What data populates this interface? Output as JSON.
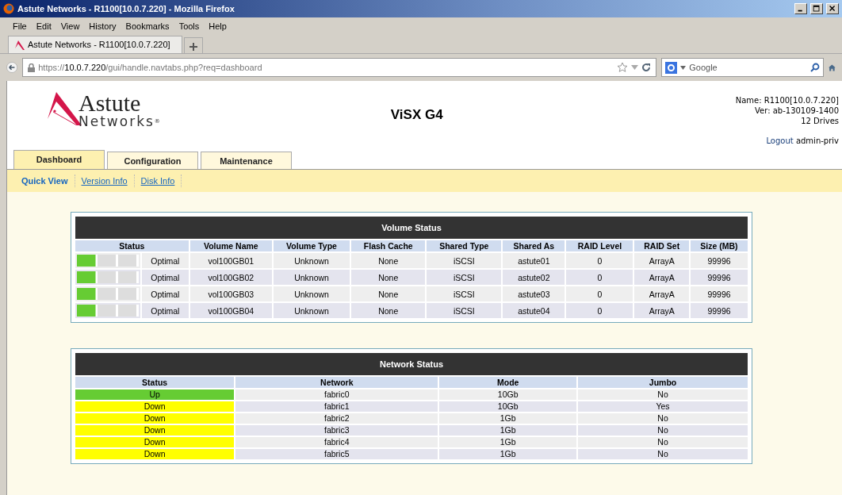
{
  "window": {
    "title": "Astute Networks - R1100[10.0.7.220] - Mozilla Firefox"
  },
  "menu": [
    "File",
    "Edit",
    "View",
    "History",
    "Bookmarks",
    "Tools",
    "Help"
  ],
  "browser_tabs": [
    {
      "label": "Astute Networks - R1100[10.0.7.220]",
      "selected": true
    }
  ],
  "address_bar": {
    "prefix": "https://",
    "host": "10.0.7.220",
    "path": "/gui/handle.navtabs.php?req=dashboard"
  },
  "search": {
    "placeholder": "Google"
  },
  "logo": {
    "name": "Astute",
    "sub": "Networks",
    "mark": "®"
  },
  "product": "ViSX G4",
  "info": [
    "Name: R1100[10.0.7.220]",
    "Ver: ab-130109-1400",
    "12 Drives"
  ],
  "logout": {
    "link": "Logout",
    "user": "admin-priv"
  },
  "tabs": [
    {
      "label": "Dashboard",
      "selected": true
    },
    {
      "label": "Configuration",
      "selected": false
    },
    {
      "label": "Maintenance",
      "selected": false
    }
  ],
  "subnav": [
    {
      "label": "Quick View",
      "selected": true
    },
    {
      "label": "Version Info",
      "selected": false
    },
    {
      "label": "Disk Info",
      "selected": false
    }
  ],
  "volume_table": {
    "title": "Volume Status",
    "columns": [
      "Status",
      "Volume Name",
      "Volume Type",
      "Flash Cache",
      "Shared Type",
      "Shared As",
      "RAID Level",
      "RAID Set",
      "Size (MB)"
    ],
    "rows": [
      {
        "level": 0.34,
        "cells": [
          "Optimal",
          "vol100GB01",
          "Unknown",
          "None",
          "iSCSI",
          "astute01",
          "0",
          "ArrayA",
          "99996"
        ]
      },
      {
        "level": 0.34,
        "cells": [
          "Optimal",
          "vol100GB02",
          "Unknown",
          "None",
          "iSCSI",
          "astute02",
          "0",
          "ArrayA",
          "99996"
        ]
      },
      {
        "level": 0.34,
        "cells": [
          "Optimal",
          "vol100GB03",
          "Unknown",
          "None",
          "iSCSI",
          "astute03",
          "0",
          "ArrayA",
          "99996"
        ]
      },
      {
        "level": 0.34,
        "cells": [
          "Optimal",
          "vol100GB04",
          "Unknown",
          "None",
          "iSCSI",
          "astute04",
          "0",
          "ArrayA",
          "99996"
        ]
      }
    ]
  },
  "network_table": {
    "title": "Network Status",
    "columns": [
      "Status",
      "Network",
      "Mode",
      "Jumbo"
    ],
    "rows": [
      {
        "color": "#66cc33",
        "cells": [
          "Up",
          "fabric0",
          "10Gb",
          "No"
        ]
      },
      {
        "color": "#ffff00",
        "cells": [
          "Down",
          "fabric1",
          "10Gb",
          "Yes"
        ]
      },
      {
        "color": "#ffff00",
        "cells": [
          "Down",
          "fabric2",
          "1Gb",
          "No"
        ]
      },
      {
        "color": "#ffff00",
        "cells": [
          "Down",
          "fabric3",
          "1Gb",
          "No"
        ]
      },
      {
        "color": "#ffff00",
        "cells": [
          "Down",
          "fabric4",
          "1Gb",
          "No"
        ]
      },
      {
        "color": "#ffff00",
        "cells": [
          "Down",
          "fabric5",
          "1Gb",
          "No"
        ]
      }
    ]
  }
}
